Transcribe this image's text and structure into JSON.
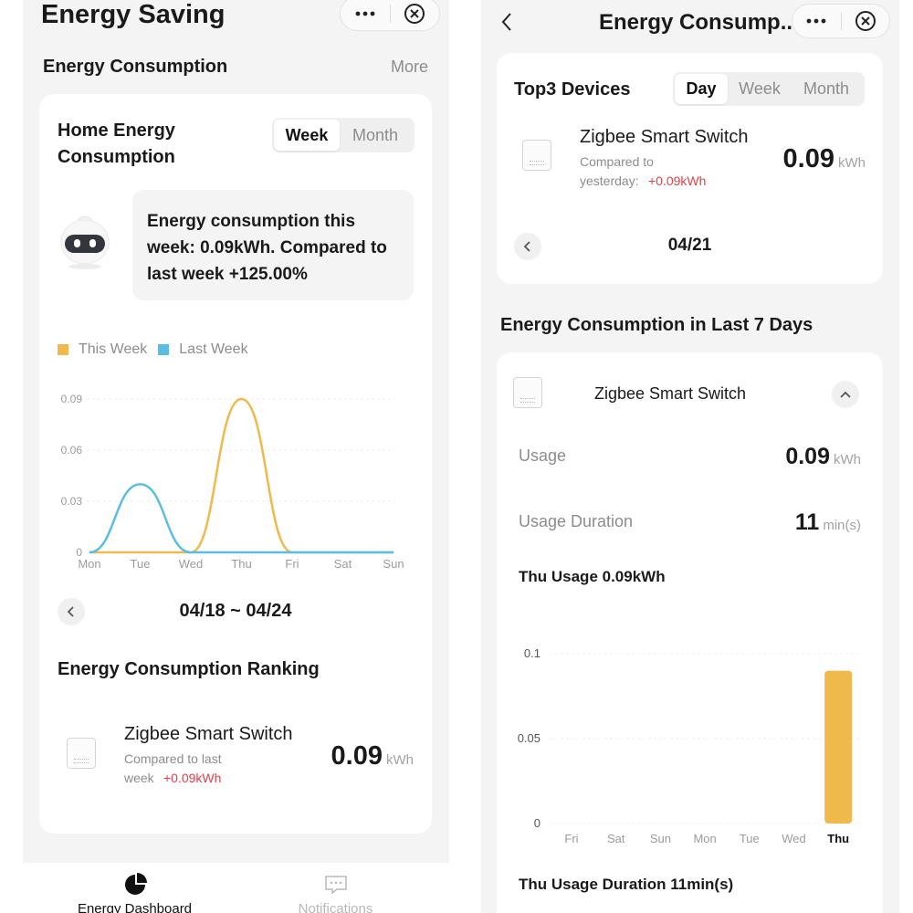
{
  "left": {
    "app_title": "Energy Saving",
    "section_title": "Energy Consumption",
    "more_label": "More",
    "card_title": "Home Energy Consumption",
    "period_tabs": [
      "Week",
      "Month"
    ],
    "summary_text": "Energy consumption this week: 0.09kWh. Compared to last week +125.00%",
    "legend": [
      "This Week",
      "Last Week"
    ],
    "date_range": "04/18 ~ 04/24",
    "ranking_title": "Energy Consumption Ranking",
    "ranking_item": {
      "name": "Zigbee Smart Switch",
      "compare_label_1": "Compared to last",
      "compare_label_2": "week",
      "compare_delta": "+0.09kWh",
      "value": "0.09",
      "unit": "kWh"
    },
    "bottom_nav": [
      "Energy Dashboard",
      "Notifications"
    ]
  },
  "right": {
    "page_title": "Energy Consump...",
    "top3_title": "Top3 Devices",
    "period_tabs": [
      "Day",
      "Week",
      "Month"
    ],
    "device": {
      "name": "Zigbee Smart Switch",
      "compare_label_1": "Compared to",
      "compare_label_2": "yesterday:",
      "compare_delta": "+0.09kWh",
      "value": "0.09",
      "unit": "kWh"
    },
    "date": "04/21",
    "last7_title": "Energy Consumption in Last 7 Days",
    "detail": {
      "device_name": "Zigbee Smart Switch",
      "usage_label": "Usage",
      "usage_value": "0.09",
      "usage_unit": "kWh",
      "duration_label": "Usage Duration",
      "duration_value": "11",
      "duration_unit": "min(s)",
      "usage_caption": "Thu Usage 0.09kWh",
      "duration_caption": "Thu Usage Duration 11min(s)"
    }
  },
  "colors": {
    "this_week": "#f0b94b",
    "last_week": "#5bbde0",
    "bar": "#f0b94b",
    "accent_red": "#e0414a"
  },
  "chart_data": [
    {
      "type": "line",
      "x": [
        "Mon",
        "Tue",
        "Wed",
        "Thu",
        "Fri",
        "Sat",
        "Sun"
      ],
      "yticks": [
        "0.09",
        "0.06",
        "0.03",
        "0"
      ],
      "ylim": [
        0,
        0.09
      ],
      "grid": true,
      "legend_position": "top-left",
      "series": [
        {
          "name": "This Week",
          "values": [
            0,
            0,
            0,
            0.09,
            0,
            0,
            0
          ]
        },
        {
          "name": "Last Week",
          "values": [
            0,
            0.04,
            0,
            0,
            0,
            0,
            0
          ]
        }
      ]
    },
    {
      "type": "bar",
      "categories": [
        "Fri",
        "Sat",
        "Sun",
        "Mon",
        "Tue",
        "Wed",
        "Thu"
      ],
      "values": [
        0,
        0,
        0,
        0,
        0,
        0,
        0.09
      ],
      "yticks": [
        "0.1",
        "0.05",
        "0"
      ],
      "ylim": [
        0,
        0.1
      ],
      "grid": true,
      "highlight_category": "Thu"
    }
  ]
}
